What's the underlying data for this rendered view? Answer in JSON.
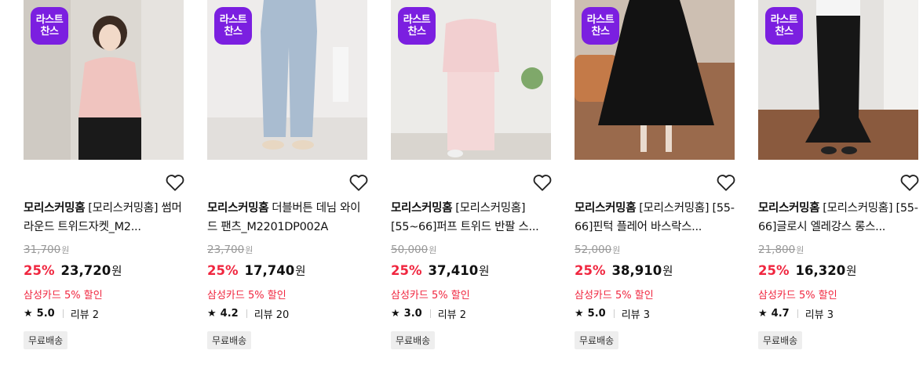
{
  "products": [
    {
      "badge_line1": "라스트",
      "badge_line2": "찬스",
      "brand": "모리스커밍홈",
      "name": "[모리스커밍홈] 썸머 라운드 트위드자켓_M2...",
      "original_price": "31,700",
      "currency": "원",
      "discount_rate": "25%",
      "price": "23,720",
      "card_discount": "삼성카드 5% 할인",
      "rating": "5.0",
      "reviews": "리뷰 2",
      "shipping": "무료배송"
    },
    {
      "badge_line1": "라스트",
      "badge_line2": "찬스",
      "brand": "모리스커밍홈",
      "name": "더블버튼 데님 와이드 팬츠_M2201DP002A",
      "original_price": "23,700",
      "currency": "원",
      "discount_rate": "25%",
      "price": "17,740",
      "card_discount": "삼성카드 5% 할인",
      "rating": "4.2",
      "reviews": "리뷰 20",
      "shipping": "무료배송"
    },
    {
      "badge_line1": "라스트",
      "badge_line2": "찬스",
      "brand": "모리스커밍홈",
      "name": "[모리스커밍홈] [55~66]퍼프 트위드 반팔 스...",
      "original_price": "50,000",
      "currency": "원",
      "discount_rate": "25%",
      "price": "37,410",
      "card_discount": "삼성카드 5% 할인",
      "rating": "3.0",
      "reviews": "리뷰 2",
      "shipping": "무료배송"
    },
    {
      "badge_line1": "라스트",
      "badge_line2": "찬스",
      "brand": "모리스커밍홈",
      "name": "[모리스커밍홈] [55-66]핀턱 플레어 바스락스...",
      "original_price": "52,000",
      "currency": "원",
      "discount_rate": "25%",
      "price": "38,910",
      "card_discount": "삼성카드 5% 할인",
      "rating": "5.0",
      "reviews": "리뷰 3",
      "shipping": "무료배송"
    },
    {
      "badge_line1": "라스트",
      "badge_line2": "찬스",
      "brand": "모리스커밍홈",
      "name": "[모리스커밍홈] [55-66]글로시 엘레강스 롱스...",
      "original_price": "21,800",
      "currency": "원",
      "discount_rate": "25%",
      "price": "16,320",
      "card_discount": "삼성카드 5% 할인",
      "rating": "4.7",
      "reviews": "리뷰 3",
      "shipping": "무료배송"
    }
  ],
  "icons": {
    "wishlist": "heart-outline-icon",
    "rating": "star-icon"
  },
  "colors": {
    "badge": "#7b1fe0",
    "discount": "#f0263f",
    "original_price": "#999999",
    "shipping_bg": "#eeeeee"
  }
}
